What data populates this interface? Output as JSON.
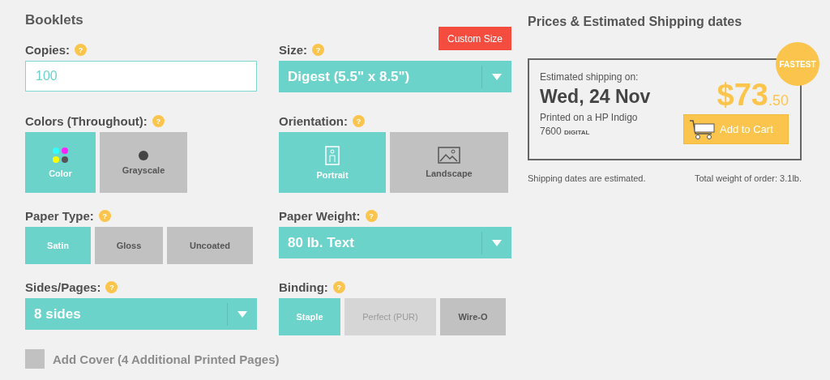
{
  "title": "Booklets",
  "copies": {
    "label": "Copies:",
    "help": "?",
    "value": "100"
  },
  "size": {
    "label": "Size:",
    "help": "?",
    "value": "Digest (5.5\" x 8.5\")",
    "custom_button": "Custom Size"
  },
  "colors": {
    "label": "Colors (Throughout):",
    "help": "?",
    "options": [
      {
        "label": "Color",
        "kind": "color",
        "selected": true
      },
      {
        "label": "Grayscale",
        "kind": "grayscale",
        "selected": false
      }
    ]
  },
  "orientation": {
    "label": "Orientation:",
    "help": "?",
    "options": [
      {
        "label": "Portrait",
        "kind": "portrait",
        "selected": true
      },
      {
        "label": "Landscape",
        "kind": "landscape",
        "selected": false
      }
    ]
  },
  "paper_type": {
    "label": "Paper Type:",
    "help": "?",
    "options": [
      {
        "label": "Satin",
        "selected": true,
        "disabled": false
      },
      {
        "label": "Gloss",
        "selected": false,
        "disabled": false
      },
      {
        "label": "Uncoated",
        "selected": false,
        "disabled": false
      }
    ]
  },
  "paper_weight": {
    "label": "Paper Weight:",
    "help": "?",
    "value": "80 lb. Text"
  },
  "sides_pages": {
    "label": "Sides/Pages:",
    "help": "?",
    "value": "8 sides"
  },
  "binding": {
    "label": "Binding:",
    "help": "?",
    "options": [
      {
        "label": "Staple",
        "selected": true,
        "disabled": false
      },
      {
        "label": "Perfect (PUR)",
        "selected": false,
        "disabled": true
      },
      {
        "label": "Wire-O",
        "selected": false,
        "disabled": false
      }
    ]
  },
  "add_cover": {
    "label": "Add Cover (4 Additional Printed Pages)",
    "checked": false
  },
  "prices": {
    "title": "Prices & Estimated Shipping dates",
    "badge": "FASTEST",
    "shipping_label": "Estimated shipping on:",
    "date": "Wed, 24 Nov",
    "printer": "Printed on a HP Indigo",
    "printer_model": "7600",
    "printer_type": "DIGITAL",
    "price_main": "$73",
    "price_cents": ".50",
    "cart_button": "Add to Cart",
    "note": "Shipping dates are estimated.",
    "weight": "Total weight of order: 3.1lb."
  }
}
